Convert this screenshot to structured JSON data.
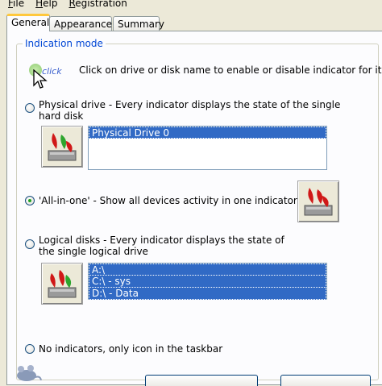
{
  "menu": {
    "file": {
      "accel": "F",
      "rest": "ile"
    },
    "help": {
      "accel": "H",
      "rest": "elp"
    },
    "registration": {
      "accel": "R",
      "rest": "egistration"
    }
  },
  "tabs": [
    {
      "label": "General"
    },
    {
      "label": "Appearance"
    },
    {
      "label": "Summary"
    }
  ],
  "group": {
    "title": "Indication mode"
  },
  "hint": {
    "click_label": "click",
    "text": "Click on drive or disk name to enable or disable indicator for it."
  },
  "options": {
    "physical": {
      "line1": "Physical drive -  Every indicator displays the state of the single",
      "line2": "hard disk",
      "checked": false
    },
    "all_in_one": {
      "text": "'All-in-one' - Show all devices activity in one indicator",
      "checked": true
    },
    "logical": {
      "line1": "Logical disks - Every indicator displays the state of",
      "line2": "the single logical drive",
      "checked": false
    },
    "none": {
      "text": "No indicators, only icon in the taskbar",
      "checked": false
    }
  },
  "physical_list": [
    "Physical Drive 0"
  ],
  "logical_list": [
    "A:\\",
    "C:\\ - sys",
    "D:\\ - Data"
  ],
  "colors": {
    "selection": "#316AC5",
    "accent": "#0046D5",
    "tab_highlight": "#FFC83C"
  }
}
